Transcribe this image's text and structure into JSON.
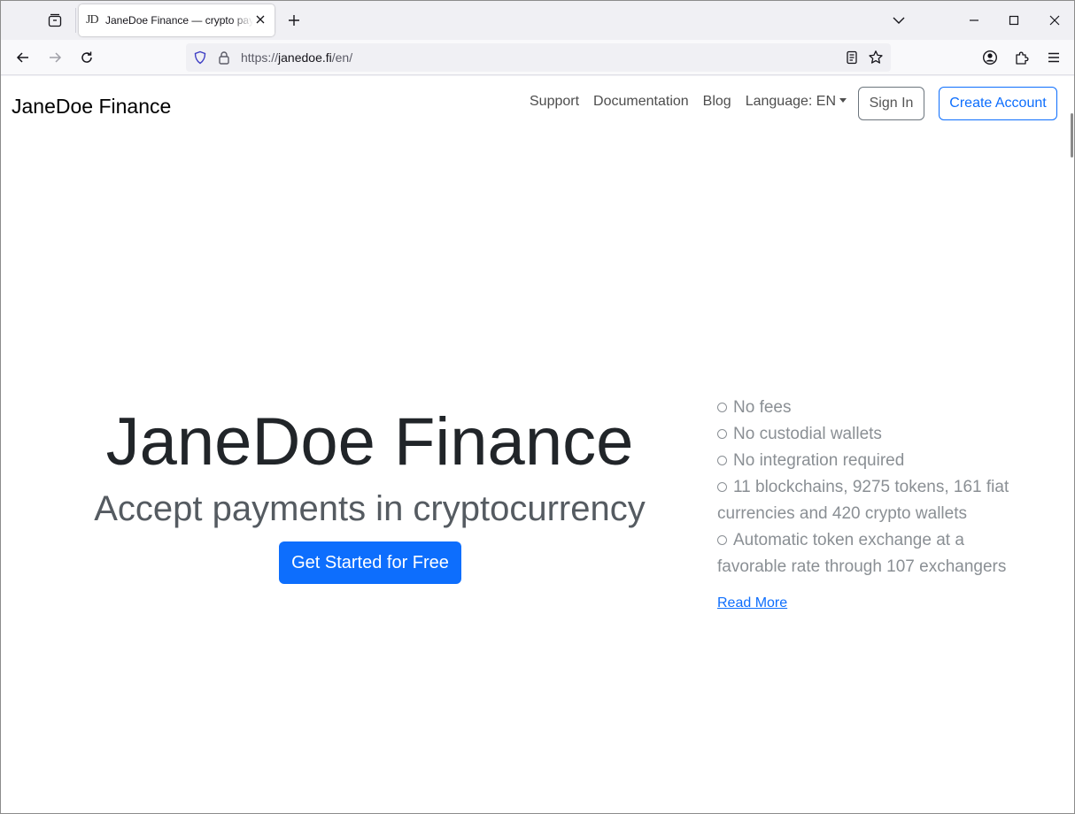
{
  "browser": {
    "tab": {
      "favicon": "JD",
      "title": "JaneDoe Finance — crypto payments"
    },
    "url": {
      "scheme": "https://",
      "host": "janedoe.fi",
      "path": "/en/"
    }
  },
  "site": {
    "brand": "JaneDoe Finance",
    "nav": {
      "support": "Support",
      "documentation": "Documentation",
      "blog": "Blog",
      "language": "Language: EN",
      "sign_in": "Sign In",
      "create_account": "Create Account"
    },
    "hero": {
      "title": "JaneDoe Finance",
      "subtitle": "Accept payments in cryptocurrency",
      "cta": "Get Started for Free"
    },
    "features": [
      "No fees",
      "No custodial wallets",
      "No integration required",
      "11 blockchains, 9275 tokens, 161 fiat currencies and 420 crypto wallets",
      "Automatic token exchange at a favorable rate through 107 exchangers"
    ],
    "read_more": "Read More"
  },
  "colors": {
    "primary": "#0d6efd",
    "text_dark": "#212529",
    "text_muted": "#8a8f94"
  }
}
